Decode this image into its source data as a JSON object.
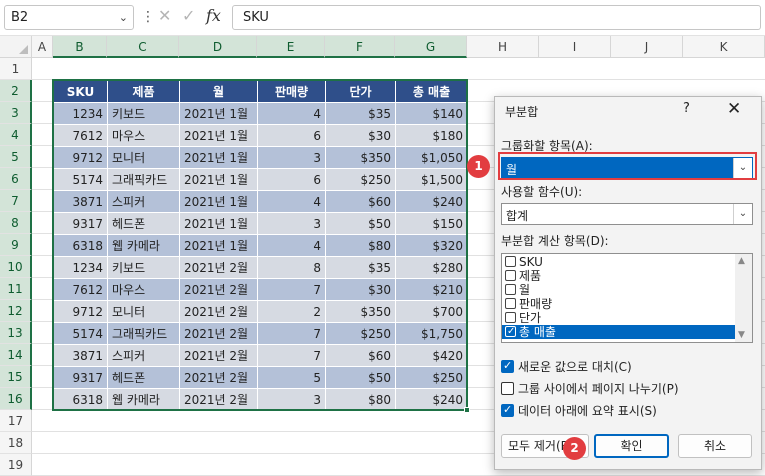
{
  "formula_bar": {
    "name_box": "B2",
    "separator": "⋮",
    "cancel_glyph": "✕",
    "enter_glyph": "✓",
    "fx_glyph": "fx",
    "formula": "SKU",
    "dropdown_glyph": "⌄"
  },
  "grid": {
    "columns": [
      "A",
      "B",
      "C",
      "D",
      "E",
      "F",
      "G",
      "H",
      "I",
      "J",
      "K"
    ],
    "rows": [
      "1",
      "2",
      "3",
      "4",
      "5",
      "6",
      "7",
      "8",
      "9",
      "10",
      "11",
      "12",
      "13",
      "14",
      "15",
      "16",
      "17",
      "18",
      "19"
    ]
  },
  "table": {
    "headers": [
      "SKU",
      "제품",
      "월",
      "판매량",
      "단가",
      "총 매출"
    ],
    "rows": [
      [
        "1234",
        "키보드",
        "2021년 1월",
        "4",
        "$35",
        "$140"
      ],
      [
        "7612",
        "마우스",
        "2021년 1월",
        "6",
        "$30",
        "$180"
      ],
      [
        "9712",
        "모니터",
        "2021년 1월",
        "3",
        "$350",
        "$1,050"
      ],
      [
        "5174",
        "그래픽카드",
        "2021년 1월",
        "6",
        "$250",
        "$1,500"
      ],
      [
        "3871",
        "스피커",
        "2021년 1월",
        "4",
        "$60",
        "$240"
      ],
      [
        "9317",
        "헤드폰",
        "2021년 1월",
        "3",
        "$50",
        "$150"
      ],
      [
        "6318",
        "웹 카메라",
        "2021년 1월",
        "4",
        "$80",
        "$320"
      ],
      [
        "1234",
        "키보드",
        "2021년 2월",
        "8",
        "$35",
        "$280"
      ],
      [
        "7612",
        "마우스",
        "2021년 2월",
        "7",
        "$30",
        "$210"
      ],
      [
        "9712",
        "모니터",
        "2021년 2월",
        "2",
        "$350",
        "$700"
      ],
      [
        "5174",
        "그래픽카드",
        "2021년 2월",
        "7",
        "$250",
        "$1,750"
      ],
      [
        "3871",
        "스피커",
        "2021년 2월",
        "7",
        "$60",
        "$420"
      ],
      [
        "9317",
        "헤드폰",
        "2021년 2월",
        "5",
        "$50",
        "$250"
      ],
      [
        "6318",
        "웹 카메라",
        "2021년 2월",
        "3",
        "$80",
        "$240"
      ]
    ]
  },
  "dialog": {
    "title": "부분합",
    "help": "?",
    "close": "✕",
    "group_by_label": "그룹화할 항목(A):",
    "group_by_value": "월",
    "function_label": "사용할 함수(U):",
    "function_value": "합계",
    "add_to_label": "부분합 계산 항목(D):",
    "add_to_items": [
      {
        "label": "SKU",
        "checked": false
      },
      {
        "label": "제품",
        "checked": false
      },
      {
        "label": "월",
        "checked": false
      },
      {
        "label": "판매량",
        "checked": false
      },
      {
        "label": "단가",
        "checked": false
      },
      {
        "label": "총 매출",
        "checked": true
      }
    ],
    "options": [
      {
        "label": "새로운 값으로 대치(C)",
        "checked": true
      },
      {
        "label": "그룹 사이에서 페이지 나누기(P)",
        "checked": false
      },
      {
        "label": "데이터 아래에 요약 표시(S)",
        "checked": true
      }
    ],
    "remove_all": "모두 제거(R)",
    "ok": "확인",
    "cancel": "취소",
    "scroll_up": "▲",
    "scroll_down": "▼"
  },
  "callouts": [
    "1",
    "2"
  ],
  "colors": {
    "header": "#2f4f8a",
    "band_odd": "#b4c1d8",
    "band_even": "#d6dae2",
    "selection": "#1e7145",
    "accent": "#0067c0",
    "callout": "#e23d40"
  }
}
